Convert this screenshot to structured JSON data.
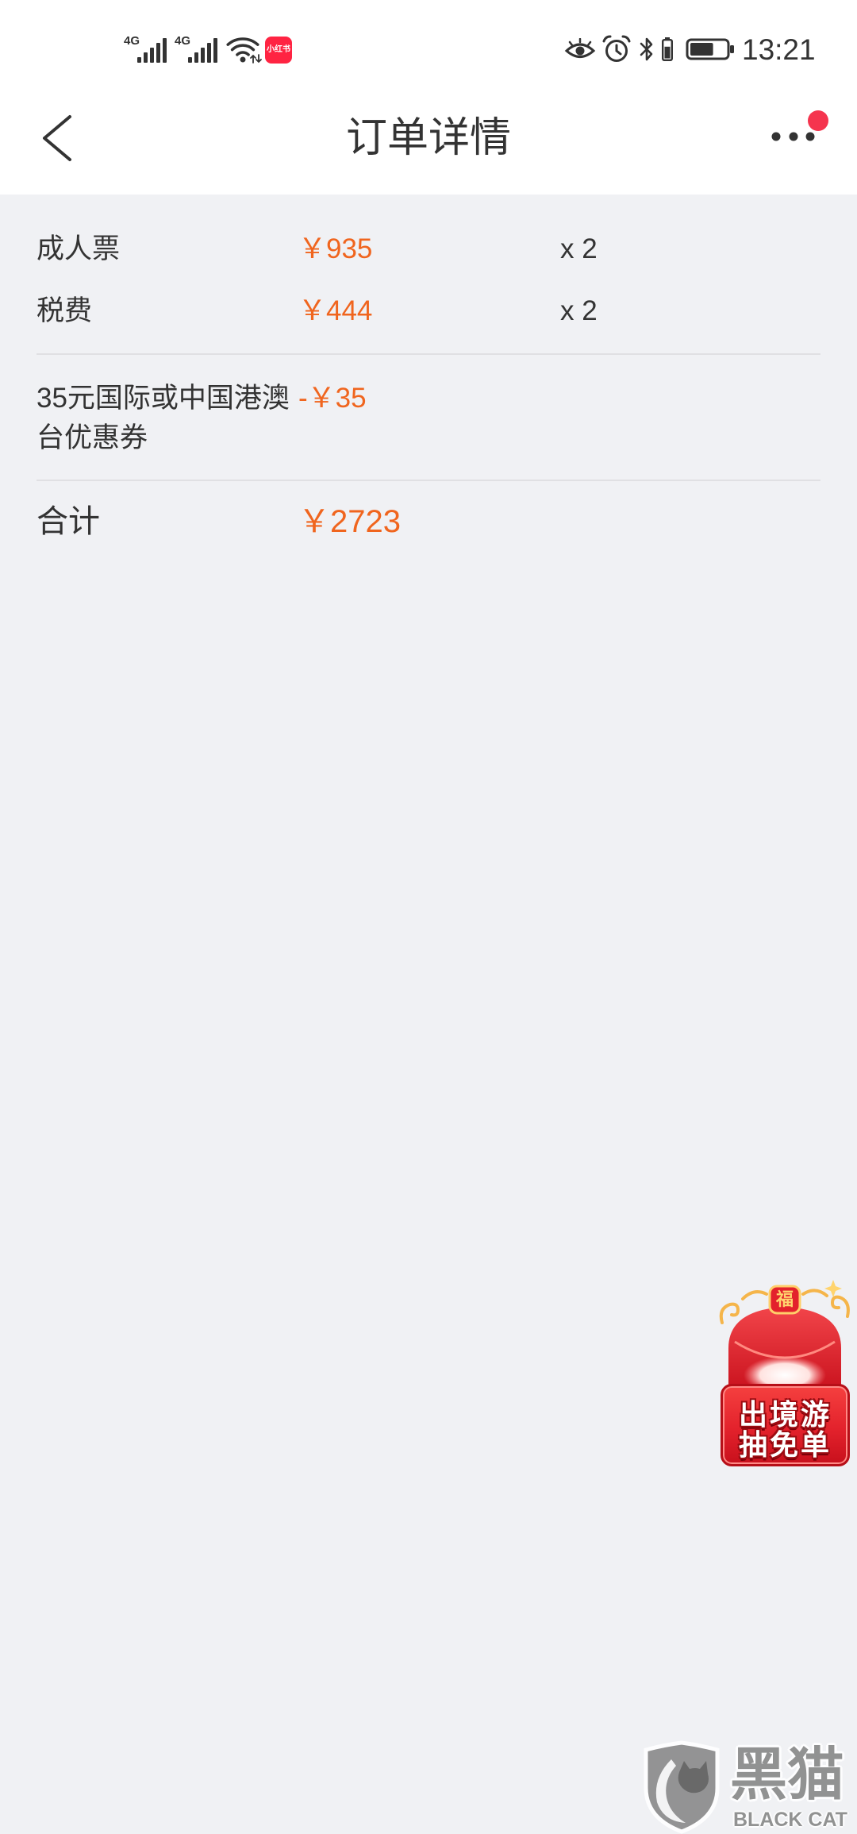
{
  "status_bar": {
    "sim1_label": "4G",
    "sim2_label": "4G",
    "app_badge_label": "小红书",
    "time": "13:21",
    "battery_level_percent": 65,
    "bluetooth_device_battery_percent": 70,
    "icons": {
      "sim1": "signal-4g-icon",
      "sim2": "signal-4g-icon",
      "wifi": "wifi-icon",
      "app": "xiaohongshu-app-icon",
      "eye": "eye-comfort-icon",
      "alarm": "alarm-icon",
      "bluetooth": "bluetooth-icon",
      "bluetooth_battery": "bluetooth-device-battery-icon",
      "battery": "battery-icon"
    }
  },
  "header": {
    "title": "订单详情",
    "back_icon": "chevron-left-icon",
    "more_icon": "more-dots-icon",
    "notification_dot_visible": true
  },
  "price_items": [
    {
      "label": "成人票",
      "price": "￥935",
      "quantity": "x 2"
    },
    {
      "label": "税费",
      "price": "￥444",
      "quantity": "x 2"
    }
  ],
  "discounts": [
    {
      "label": "35元国际或中国港澳台优惠券",
      "amount": "-￥35"
    }
  ],
  "total": {
    "label": "合计",
    "amount": "￥2723"
  },
  "promo_float": {
    "icon": "red-envelope-gift-icon",
    "seal_char": "福",
    "line1": "出境游",
    "line2": "抽免单"
  },
  "watermark": {
    "icon": "black-cat-shield-logo-icon",
    "logo_text": "黑猫",
    "logo_subtext": "BLACK CAT"
  },
  "colors": {
    "price_accent": "#f0651e",
    "text_primary": "#333333",
    "page_background": "#f0f1f4",
    "header_background": "#ffffff",
    "divider": "#e0e0e3",
    "notification_dot": "#f5344e",
    "promo_red": "#e3222c",
    "watermark_gray": "#8a8a8a",
    "app_icon_red": "#ff2442"
  }
}
